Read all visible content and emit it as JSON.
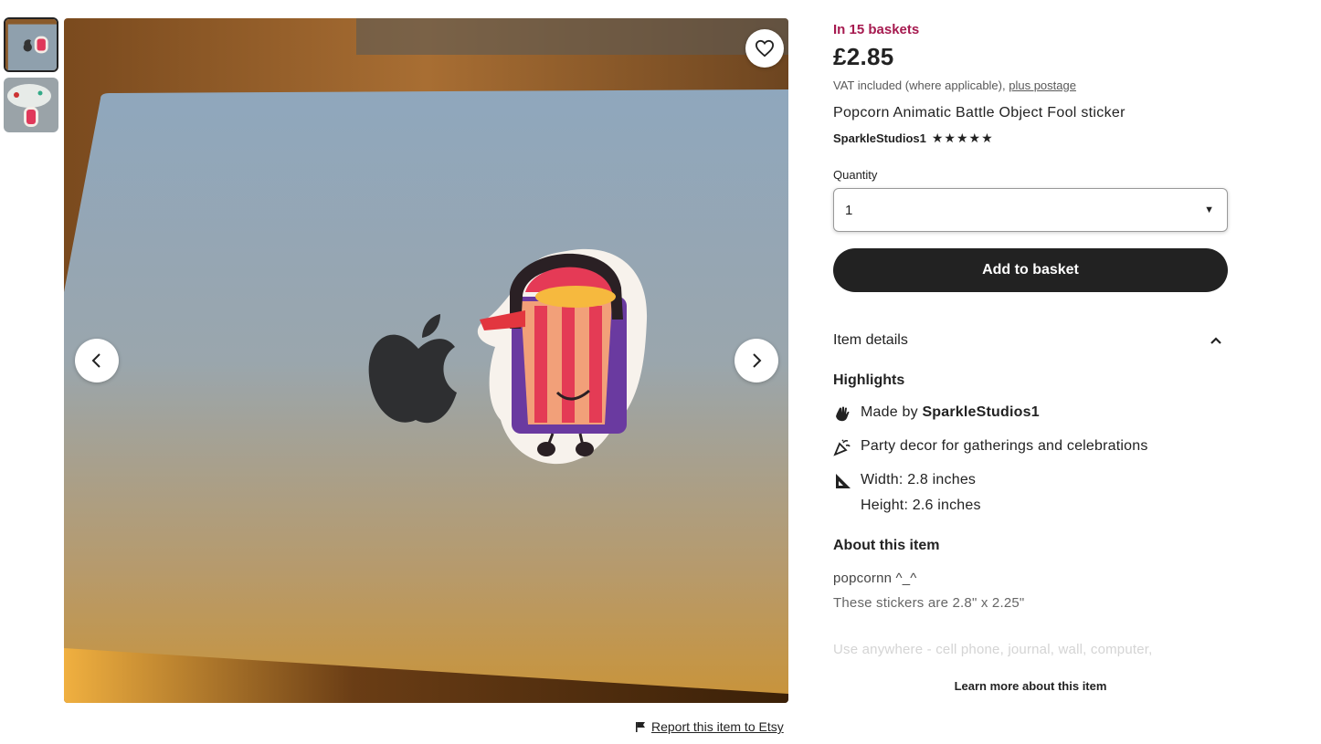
{
  "gallery": {
    "thumbnails": [
      {
        "name": "thumbnail-laptop-sticker",
        "active": true
      },
      {
        "name": "thumbnail-controller-sticker",
        "active": false
      }
    ],
    "favorite_icon": "heart-icon",
    "prev_icon": "chevron-left-icon",
    "next_icon": "chevron-right-icon"
  },
  "report": {
    "icon": "flag-icon",
    "label": "Report this item to Etsy"
  },
  "product": {
    "baskets": "In 15 baskets",
    "price": "£2.85",
    "vat_text": "VAT included (where applicable),",
    "postage_link": "plus postage",
    "title": "Popcorn Animatic Battle Object Fool sticker",
    "seller": "SparkleStudios1",
    "rating_stars": 5,
    "stars_text": "★★★★★"
  },
  "quantity": {
    "label": "Quantity",
    "value": "1"
  },
  "actions": {
    "add_to_basket": "Add to basket"
  },
  "details": {
    "heading": "Item details",
    "highlights_heading": "Highlights",
    "made_by_prefix": "Made by",
    "made_by_seller": "SparkleStudios1",
    "party": "Party decor for gatherings and celebrations",
    "width": "Width: 2.8 inches",
    "height": "Height: 2.6 inches",
    "about_heading": "About this item",
    "about_line1": "popcornn ^_^",
    "about_line2": "These stickers are 2.8\" x 2.25\"",
    "about_line3": "Use anywhere - cell phone, journal, wall, computer,",
    "learn_more": "Learn more about this item"
  },
  "colors": {
    "accent_baskets": "#a61a4f",
    "button_dark": "#222222"
  }
}
